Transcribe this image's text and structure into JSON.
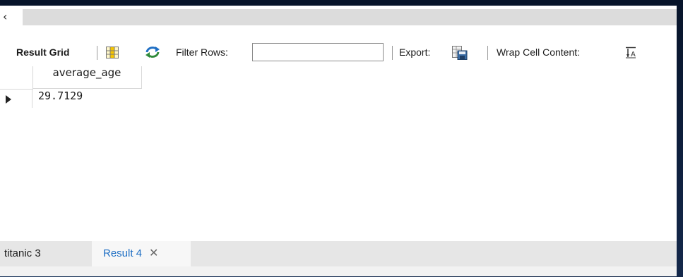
{
  "toolbar": {
    "result_grid_label": "Result Grid",
    "filter_label": "Filter Rows:",
    "filter_value": "",
    "export_label": "Export:",
    "wrap_label": "Wrap Cell Content:"
  },
  "grid": {
    "columns": [
      "average_age"
    ],
    "rows": [
      [
        "29.7129"
      ]
    ]
  },
  "tabs": [
    {
      "label": "titanic 3",
      "active": false
    },
    {
      "label": "Result 4",
      "active": true
    }
  ],
  "icons": {
    "collapse": "chevron-left-icon",
    "grid": "grid-view-icon",
    "refresh": "refresh-icon",
    "export": "export-icon",
    "wrap": "wrap-text-icon",
    "close": "close-icon"
  },
  "colors": {
    "accent": "#1f6fc4",
    "tab_bar": "#e6e6e6"
  }
}
